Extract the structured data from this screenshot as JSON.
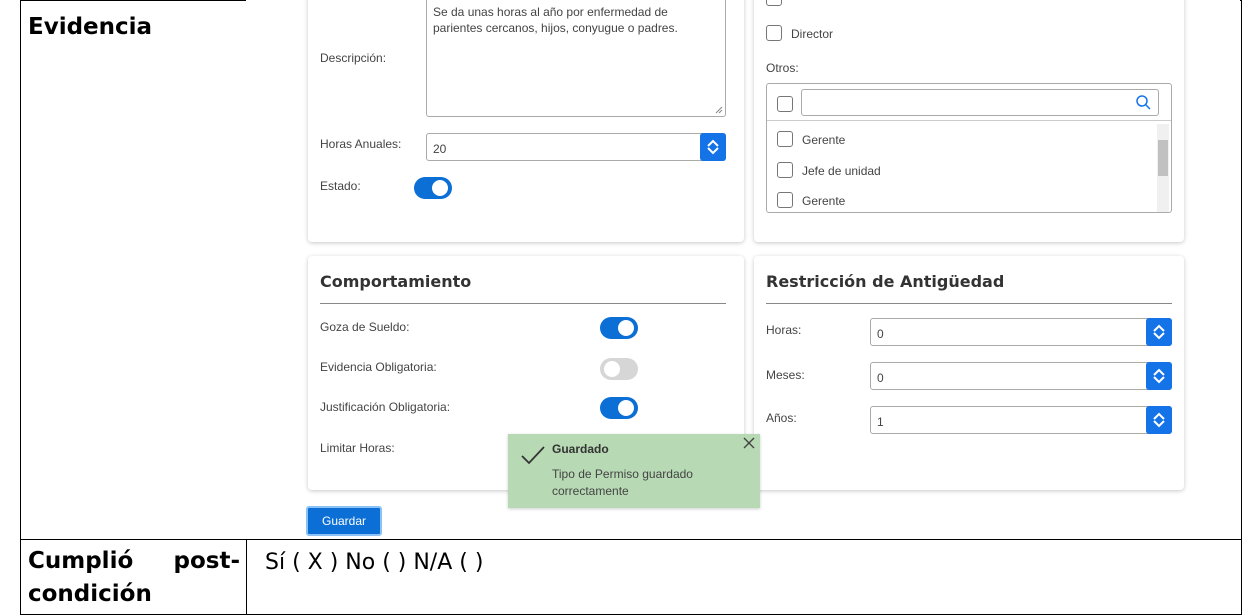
{
  "document": {
    "evidence_label": "Evidencia",
    "postcondition_label_line1": "Cumplió post-",
    "postcondition_label_line2": "condición",
    "postcondition_value": "Sí ( X ) No ( )  N/A ( )"
  },
  "form": {
    "description_label": "Descripción:",
    "description_value": "Se da unas horas al año por enfermedad de parientes cercanos, hijos, conyugue o padres.",
    "annual_hours_label": "Horas Anuales:",
    "annual_hours_value": "20",
    "status_label": "Estado:",
    "status_on": true
  },
  "roles": {
    "director_label": "Director",
    "others_label": "Otros:",
    "search_placeholder": "",
    "items": [
      "Gerente",
      "Jefe de unidad",
      "Gerente"
    ]
  },
  "behavior": {
    "title": "Comportamiento",
    "rows": [
      {
        "label": "Goza de Sueldo:",
        "on": true
      },
      {
        "label": "Evidencia Obligatoria:",
        "on": false
      },
      {
        "label": "Justificación Obligatoria:",
        "on": true
      },
      {
        "label": "Limitar Horas:",
        "on": null
      }
    ]
  },
  "seniority": {
    "title": "Restricción de Antigüedad",
    "hours_label": "Horas:",
    "hours_value": "0",
    "months_label": "Meses:",
    "months_value": "0",
    "years_label": "Años:",
    "years_value": "1"
  },
  "save_button_label": "Guardar",
  "toast": {
    "title": "Guardado",
    "message_line1": "Tipo de Permiso guardado",
    "message_line2": "correctamente"
  },
  "colors": {
    "accent": "#0b6fd6",
    "toast_bg": "#b7d9b4"
  },
  "icons": [
    "search-icon",
    "chevron-up-icon",
    "chevron-down-icon",
    "check-icon",
    "close-icon"
  ]
}
